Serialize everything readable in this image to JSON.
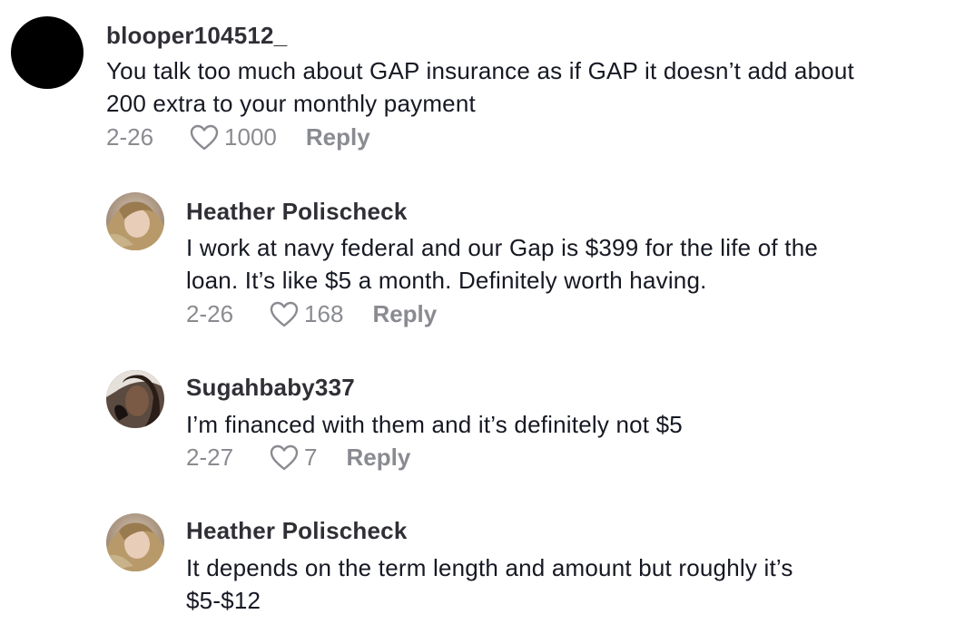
{
  "comments": [
    {
      "username": "blooper104512_",
      "text_lines": [
        "You talk too much about GAP insurance as if GAP it doesn’t add about",
        "200 extra to your monthly payment"
      ],
      "date": "2-26",
      "likes": "1000",
      "reply_label": "Reply",
      "avatar": "black-circle"
    },
    {
      "username": "Heather Polischeck",
      "text_lines": [
        "I work at navy federal and our Gap is $399 for the life of the",
        "loan. It’s like $5 a month. Definitely worth having."
      ],
      "date": "2-26",
      "likes": "168",
      "reply_label": "Reply",
      "avatar": "profile-photo"
    },
    {
      "username": "Sugahbaby337",
      "text_lines": [
        "I’m financed with them and it’s definitely not $5"
      ],
      "date": "2-27",
      "likes": "7",
      "reply_label": "Reply",
      "avatar": "profile-photo"
    },
    {
      "username": "Heather Polischeck",
      "text_lines": [
        "It depends on the term length and amount but roughly it’s",
        "$5-$12"
      ],
      "avatar": "profile-photo"
    }
  ]
}
